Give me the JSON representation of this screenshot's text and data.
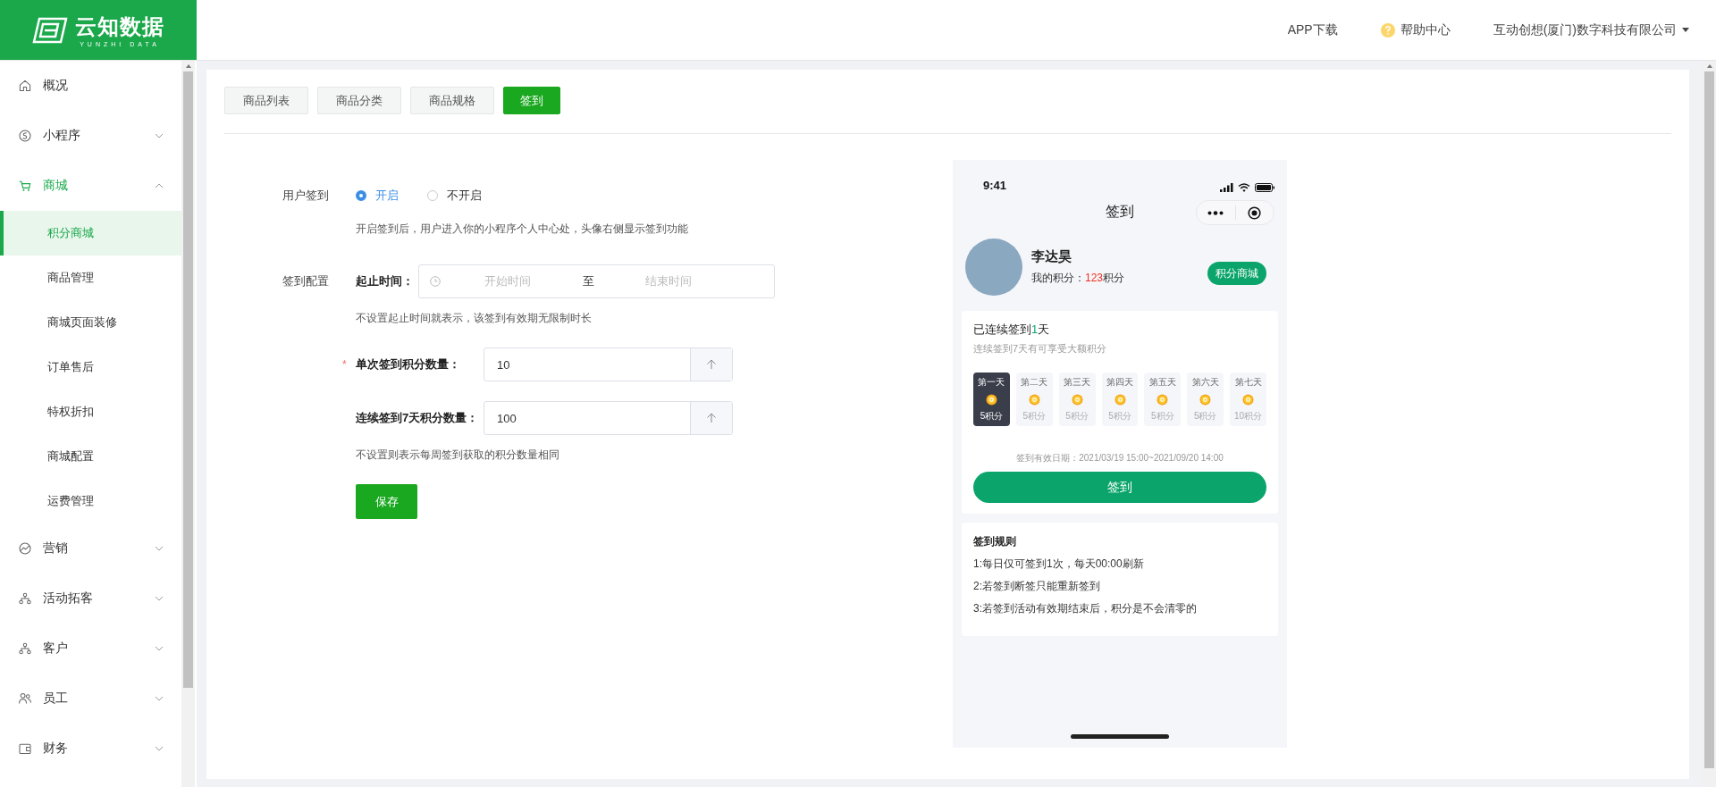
{
  "header": {
    "logo": {
      "name": "云知数据",
      "sub": "YUNZHI DATA"
    },
    "links": [
      {
        "kind": "text",
        "label": "APP下载"
      },
      {
        "kind": "help",
        "label": "帮助中心"
      },
      {
        "kind": "dropdown",
        "label": "互动创想(厦门)数字科技有限公司"
      }
    ]
  },
  "sidebar": {
    "items": [
      {
        "kind": "link",
        "label": "概况"
      },
      {
        "kind": "group",
        "label": "小程序",
        "expanded": false
      },
      {
        "kind": "group",
        "label": "商城",
        "expanded": true,
        "children": [
          {
            "label": "积分商城",
            "selected": true
          },
          {
            "label": "商品管理",
            "selected": false
          },
          {
            "label": "商城页面装修",
            "selected": false
          },
          {
            "label": "订单售后",
            "selected": false
          },
          {
            "label": "特权折扣",
            "selected": false
          },
          {
            "label": "商城配置",
            "selected": false
          },
          {
            "label": "运费管理",
            "selected": false
          }
        ]
      },
      {
        "kind": "group",
        "label": "营销",
        "expanded": false
      },
      {
        "kind": "group",
        "label": "活动拓客",
        "expanded": false
      },
      {
        "kind": "group",
        "label": "客户",
        "expanded": false
      },
      {
        "kind": "group",
        "label": "员工",
        "expanded": false
      },
      {
        "kind": "group",
        "label": "财务",
        "expanded": false
      }
    ]
  },
  "tabs": [
    {
      "label": "商品列表",
      "selected": false
    },
    {
      "label": "商品分类",
      "selected": false
    },
    {
      "label": "商品规格",
      "selected": false
    },
    {
      "label": "签到",
      "selected": true
    }
  ],
  "form": {
    "user_signin": {
      "label": "用户签到",
      "options": [
        {
          "label": "开启",
          "selected": true
        },
        {
          "label": "不开启",
          "selected": false
        }
      ],
      "hint": "开启签到后，用户进入你的小程序个人中心处，头像右侧显示签到功能"
    },
    "config": {
      "label": "签到配置",
      "time_label": "起止时间：",
      "start_placeholder": "开始时间",
      "separator": "至",
      "end_placeholder": "结束时间",
      "hint": "不设置起止时间就表示，该签到有效期无限制时长"
    },
    "required_mark": "*",
    "fields": [
      {
        "label": "单次签到积分数量：",
        "required": true,
        "value": "10"
      },
      {
        "label": "连续签到7天积分数量：",
        "required": false,
        "value": "100"
      }
    ],
    "fields_hint": "不设置则表示每周签到获取的积分数量相同",
    "save": "保存"
  },
  "phone": {
    "time": "9:41",
    "title": "签到",
    "user": {
      "name": "李达昊",
      "points_label": "我的积分：",
      "points": "123",
      "points_unit": "积分",
      "mall_button": "积分商城"
    },
    "streak": {
      "title_before": "已连续签到",
      "count": "1",
      "title_after": "天",
      "subtitle": "连续签到7天有可享受大额积分",
      "days": [
        {
          "label": "第一天",
          "points": "5积分",
          "selected": true
        },
        {
          "label": "第二天",
          "points": "5积分",
          "selected": false
        },
        {
          "label": "第三天",
          "points": "5积分",
          "selected": false
        },
        {
          "label": "第四天",
          "points": "5积分",
          "selected": false
        },
        {
          "label": "第五天",
          "points": "5积分",
          "selected": false
        },
        {
          "label": "第六天",
          "points": "5积分",
          "selected": false
        },
        {
          "label": "第七天",
          "points": "10积分",
          "selected": false
        }
      ],
      "validity": "签到有效日期：2021/03/19 15:00~2021/09/20 14:00",
      "button": "签到"
    },
    "rules": {
      "title": "签到规则",
      "items": [
        "1:每日仅可签到1次，每天00:00刷新",
        "2:若签到断签只能重新签到",
        "3:若签到活动有效期结束后，积分是不会清零的"
      ]
    }
  }
}
